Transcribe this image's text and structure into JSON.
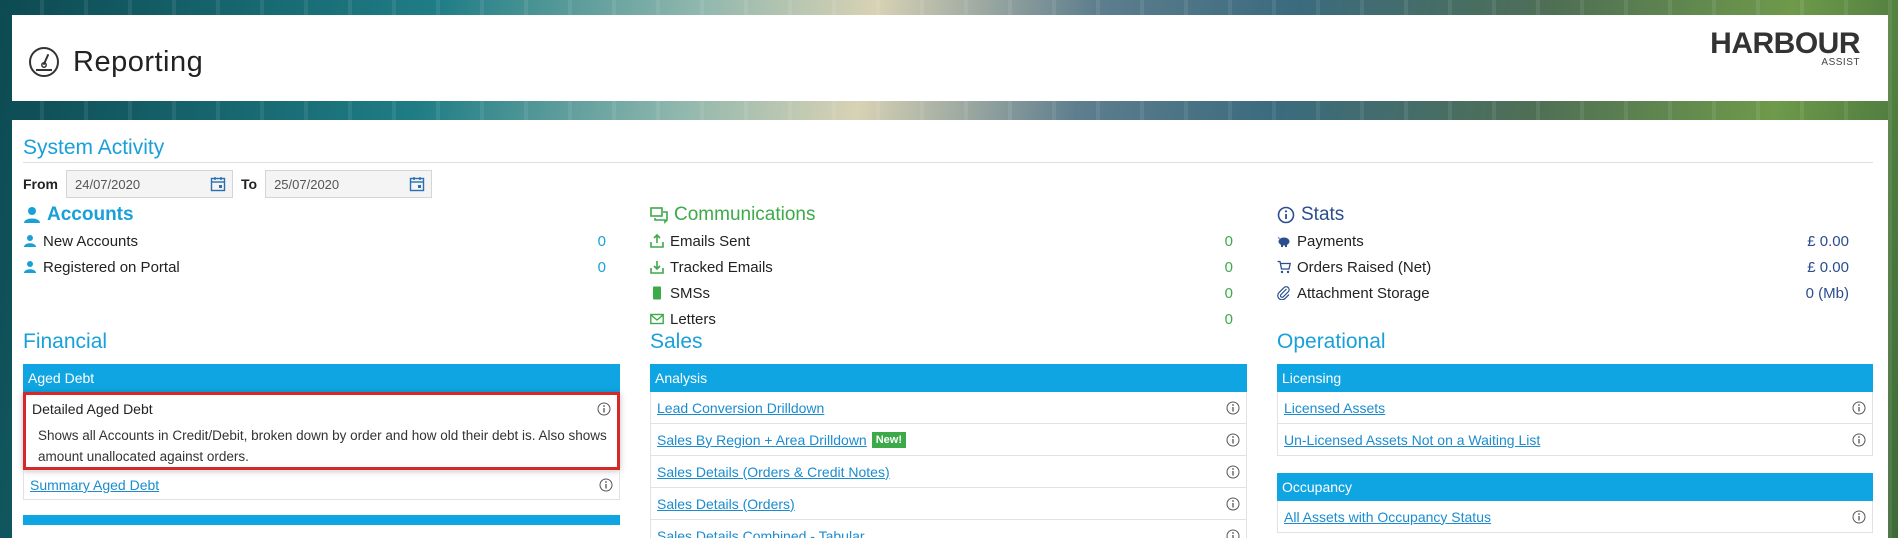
{
  "header": {
    "title": "Reporting",
    "logo_brand": "HARBOUR",
    "logo_sub": "ASSIST"
  },
  "system": {
    "title": "System Activity",
    "from_label": "From",
    "from_value": "24/07/2020",
    "to_label": "To",
    "to_value": "25/07/2020"
  },
  "accounts": {
    "title": "Accounts",
    "rows": [
      {
        "label": "New Accounts",
        "value": "0"
      },
      {
        "label": "Registered on Portal",
        "value": "0"
      }
    ]
  },
  "communications": {
    "title": "Communications",
    "rows": [
      {
        "label": "Emails Sent",
        "value": "0"
      },
      {
        "label": "Tracked Emails",
        "value": "0"
      },
      {
        "label": "SMSs",
        "value": "0"
      },
      {
        "label": "Letters",
        "value": "0"
      }
    ]
  },
  "stats": {
    "title": "Stats",
    "rows": [
      {
        "label": "Payments",
        "value": "£ 0.00"
      },
      {
        "label": "Orders Raised (Net)",
        "value": "£ 0.00"
      },
      {
        "label": "Attachment Storage",
        "value": "0 (Mb)"
      }
    ]
  },
  "financial": {
    "title": "Financial",
    "group": "Aged Debt",
    "items": [
      {
        "label": "Detailed Aged Debt",
        "description": "Shows all Accounts in Credit/Debit, broken down by order and how old their debt is. Also shows amount unallocated against orders."
      },
      {
        "label": "Summary Aged Debt"
      }
    ]
  },
  "sales": {
    "title": "Sales",
    "group": "Analysis",
    "items": [
      {
        "label": "Lead Conversion Drilldown"
      },
      {
        "label": "Sales By Region + Area Drilldown",
        "badge": "New!"
      },
      {
        "label": "Sales Details (Orders & Credit Notes)"
      },
      {
        "label": "Sales Details (Orders)"
      },
      {
        "label": "Sales Details Combined - Tabular"
      }
    ]
  },
  "operational": {
    "title": "Operational",
    "licensing_group": "Licensing",
    "licensing_items": [
      {
        "label": "Licensed Assets"
      },
      {
        "label": "Un-Licensed Assets Not on a Waiting List"
      }
    ],
    "occupancy_group": "Occupancy",
    "occupancy_items": [
      {
        "label": "All Assets with Occupancy Status"
      }
    ]
  },
  "colors": {
    "accent": "#1aa0d8",
    "bar": "#0ea5e2",
    "green": "#3daa4a",
    "navy": "#2a4e8e",
    "highlight": "#d62828"
  }
}
